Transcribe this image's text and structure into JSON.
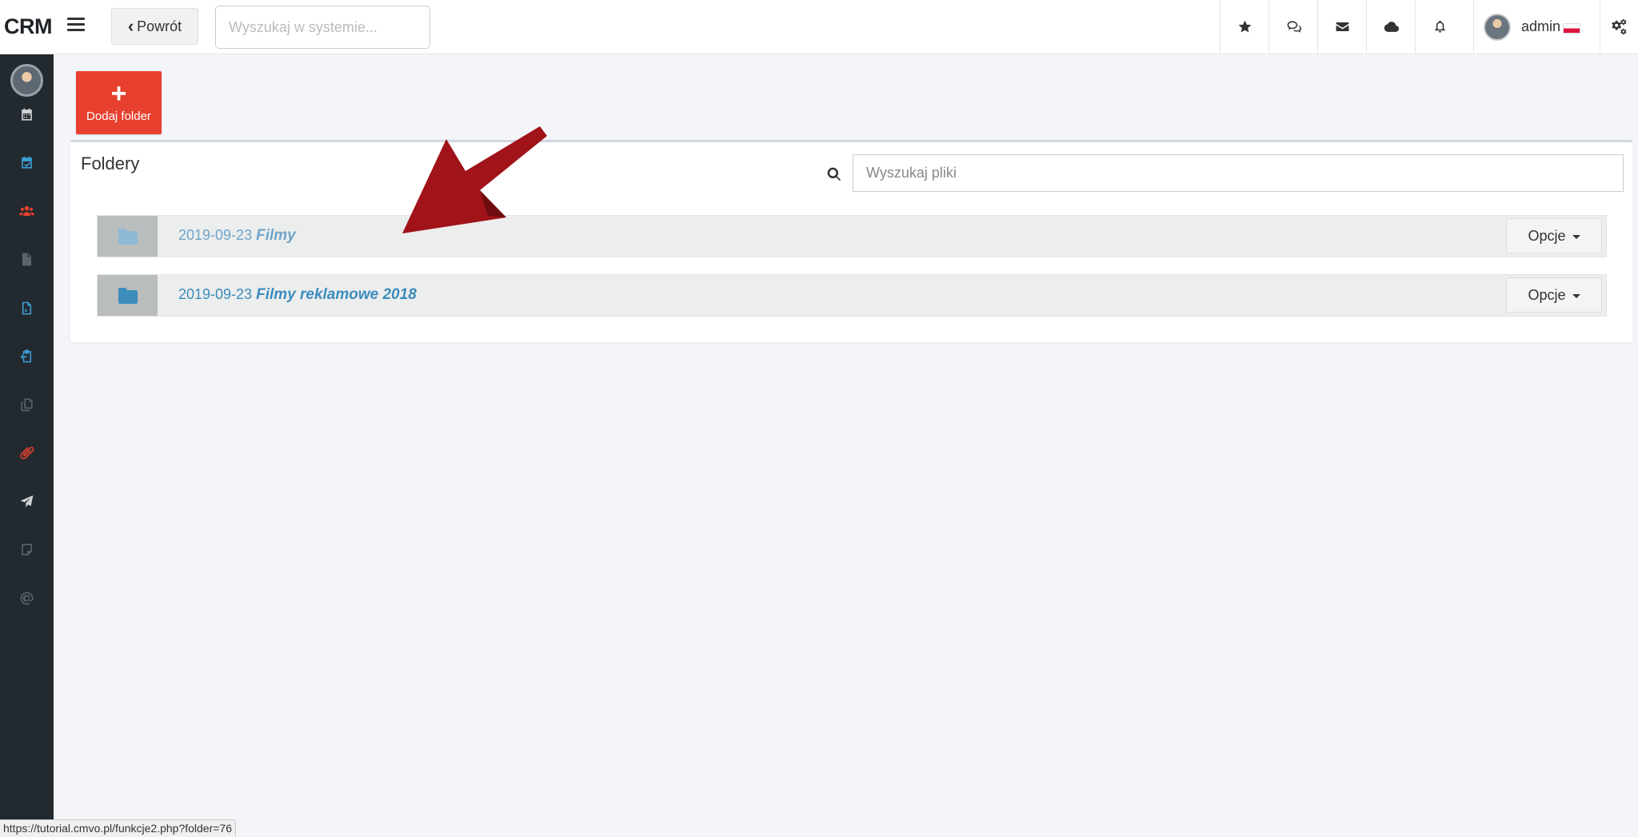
{
  "app": {
    "logo": "CRM"
  },
  "header": {
    "back_label": "Powrót",
    "search_placeholder": "Wyszukaj w systemie...",
    "icons": [
      "star-icon",
      "comments-icon",
      "envelope-icon",
      "cloud-icon",
      "bell-icon"
    ],
    "user_name": "admin",
    "settings_icon": "cogs-icon"
  },
  "sidebar": {
    "items": [
      {
        "icon": "calendar-icon",
        "color": "#cfd3d6"
      },
      {
        "icon": "calendar-check-icon",
        "color": "#3c9fd6"
      },
      {
        "icon": "users-icon",
        "color": "#e7402f"
      },
      {
        "icon": "file-icon",
        "color": "#5b646b"
      },
      {
        "icon": "file-pdf-icon",
        "color": "#3c9fd6"
      },
      {
        "icon": "clipboard-icon",
        "color": "#3c9fd6"
      },
      {
        "icon": "copy-icon",
        "color": "#5b646b"
      },
      {
        "icon": "paperclip-icon",
        "color": "#e7402f"
      },
      {
        "icon": "paper-plane-icon",
        "color": "#cfd3d6"
      },
      {
        "icon": "sticky-note-icon",
        "color": "#5b646b"
      },
      {
        "icon": "at-icon",
        "color": "#5b646b"
      }
    ]
  },
  "actions": {
    "add_folder_label": "Dodaj folder"
  },
  "folders_panel": {
    "title": "Foldery",
    "search_placeholder": "Wyszukaj pliki",
    "folders": [
      {
        "date": "2019-09-23",
        "name": "Filmy",
        "options_label": "Opcje"
      },
      {
        "date": "2019-09-23",
        "name": "Filmy reklamowe 2018",
        "options_label": "Opcje"
      }
    ]
  },
  "status_bar": {
    "url": "https://tutorial.cmvo.pl/funkcje2.php?folder=76"
  },
  "colors": {
    "accent_red": "#e7402f",
    "link_blue": "#3c8dbc",
    "sidebar_bg": "#232a2f",
    "annotation_arrow": "#a01319"
  }
}
